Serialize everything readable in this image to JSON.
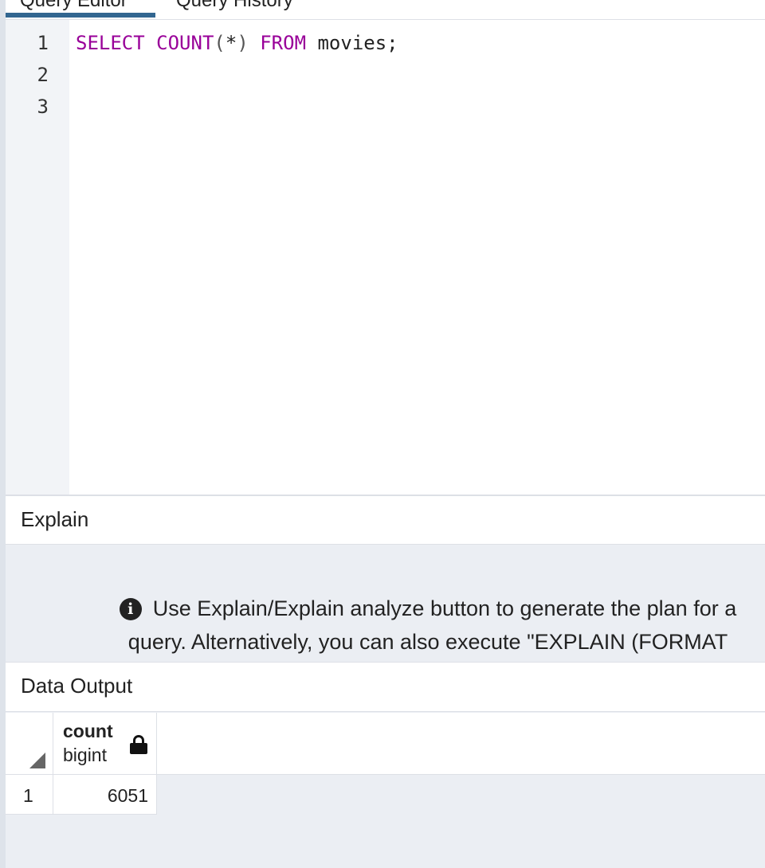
{
  "tabs": [
    {
      "label": "Query Editor",
      "active": true
    },
    {
      "label": "Query History",
      "active": false
    }
  ],
  "editor": {
    "line_numbers": [
      "1",
      "2",
      "3"
    ],
    "tokens": {
      "select": "SELECT",
      "count": "COUNT",
      "paren_open": "(",
      "star": "*",
      "paren_close": ")",
      "from": "FROM",
      "table": "movies",
      "semicolon": ";"
    }
  },
  "explain": {
    "title": "Explain",
    "message": "Use Explain/Explain analyze button to generate the plan for a query. Alternatively, you can also execute \"EXPLAIN (FORMAT JSON)"
  },
  "data_output": {
    "title": "Data Output",
    "columns": [
      {
        "name": "count",
        "type": "bigint"
      }
    ],
    "rows": [
      {
        "row_number": "1",
        "values": [
          "6051"
        ]
      }
    ]
  },
  "colors": {
    "keyword": "#990099",
    "active_tab_underline": "#326690",
    "panel_background": "#ebeef3"
  },
  "icons": [
    "info-icon",
    "lock-icon",
    "sort-corner-icon"
  ]
}
